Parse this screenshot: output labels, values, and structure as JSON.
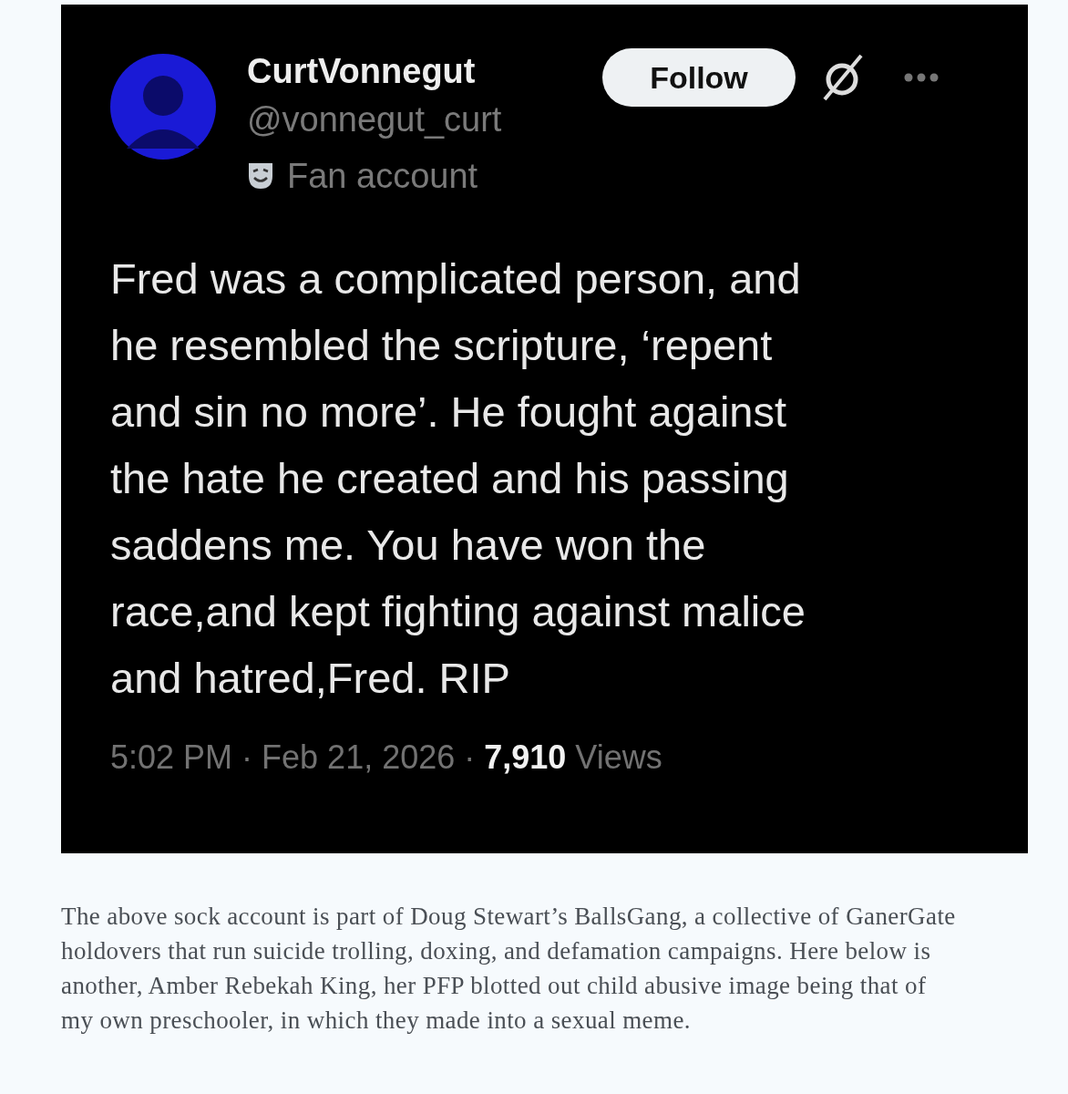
{
  "tweet": {
    "display_name": "CurtVonnegut",
    "handle": "@vonnegut_curt",
    "label": "Fan account",
    "follow_button": "Follow",
    "text": "Fred was a complicated person, and\nhe resembled the scripture, ‘repent\nand sin no more’. He fought against\nthe hate he created and his passing\nsaddens me. You have won the\nrace,and kept fighting against malice\nand hatred,Fred. RIP",
    "time": "5:02 PM",
    "separator": "·",
    "date": "Feb 21, 2026",
    "views_count": "7,910",
    "views_label": "Views"
  },
  "caption": "The above sock account is part of Doug Stewart’s BallsGang, a collective of GanerGate\nholdovers that run suicide trolling, doxing, and defamation campaigns. Here below is\nanother, Amber Rebekah King, her PFP blotted out child abusive image being that of\nmy own preschooler, in which they made into a sexual meme."
}
